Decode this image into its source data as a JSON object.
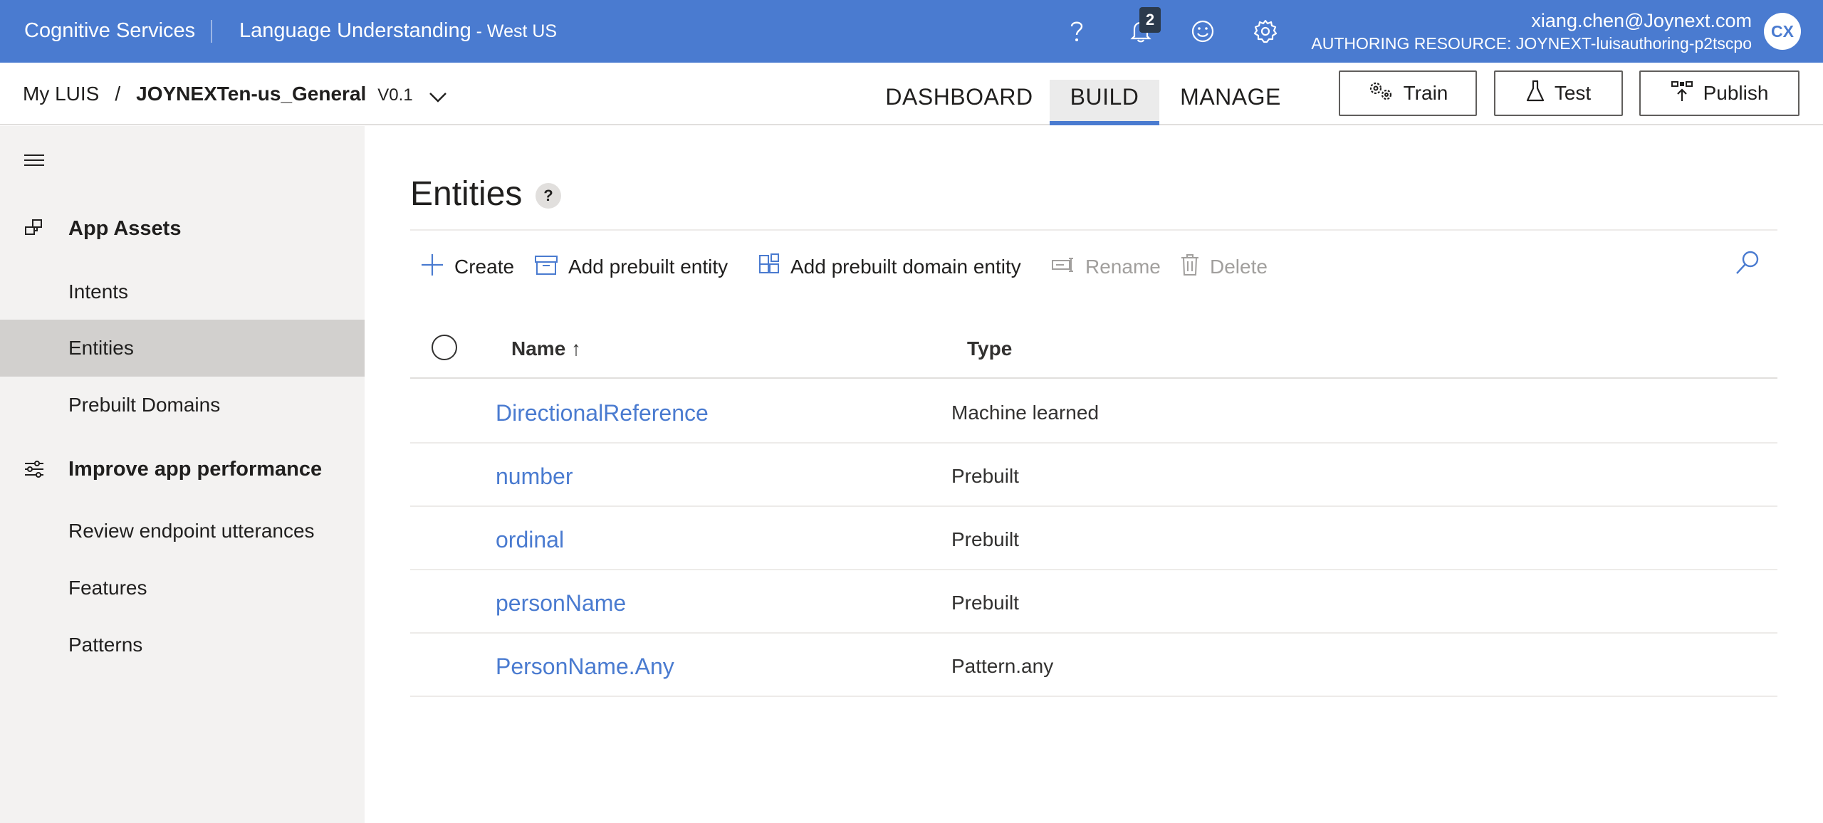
{
  "topbar": {
    "brand": "Cognitive Services",
    "product": "Language Understanding",
    "region": " - West US",
    "notification_count": "2",
    "user_email": "xiang.chen@Joynext.com",
    "authoring_resource": "AUTHORING RESOURCE:  JOYNEXT-luisauthoring-p2tscpo",
    "avatar_initials": "CX",
    "icons": [
      "help-icon",
      "bell-icon",
      "smiley-icon",
      "gear-icon"
    ]
  },
  "appbar": {
    "breadcrumb_root": "My LUIS",
    "breadcrumb_sep": "/",
    "app_name": "JOYNEXTen-us_General",
    "version": "V0.1",
    "tabs": [
      "DASHBOARD",
      "BUILD",
      "MANAGE"
    ],
    "active_tab": "BUILD",
    "train_label": "Train",
    "test_label": "Test",
    "publish_label": "Publish"
  },
  "sidebar": {
    "group_assets": "App Assets",
    "items_assets": [
      "Intents",
      "Entities",
      "Prebuilt Domains"
    ],
    "group_improve": "Improve app performance",
    "items_improve": [
      "Review endpoint utterances",
      "Features",
      "Patterns"
    ],
    "active_item": "Entities"
  },
  "main": {
    "title": "Entities",
    "help_glyph": "?",
    "commands": {
      "create": "Create",
      "add_prebuilt_entity": "Add prebuilt entity",
      "add_prebuilt_domain_entity": "Add prebuilt domain entity",
      "rename": "Rename",
      "delete": "Delete"
    },
    "columns": {
      "name": "Name",
      "sort_glyph": "↑",
      "type": "Type"
    },
    "rows": [
      {
        "name": "DirectionalReference",
        "type": "Machine learned"
      },
      {
        "name": "number",
        "type": "Prebuilt"
      },
      {
        "name": "ordinal",
        "type": "Prebuilt"
      },
      {
        "name": "personName",
        "type": "Prebuilt"
      },
      {
        "name": "PersonName.Any",
        "type": "Pattern.any"
      }
    ]
  },
  "colors": {
    "accent": "#4a7bd0",
    "sidebar_bg": "#f3f2f1",
    "sidebar_active": "#d2d0ce"
  }
}
